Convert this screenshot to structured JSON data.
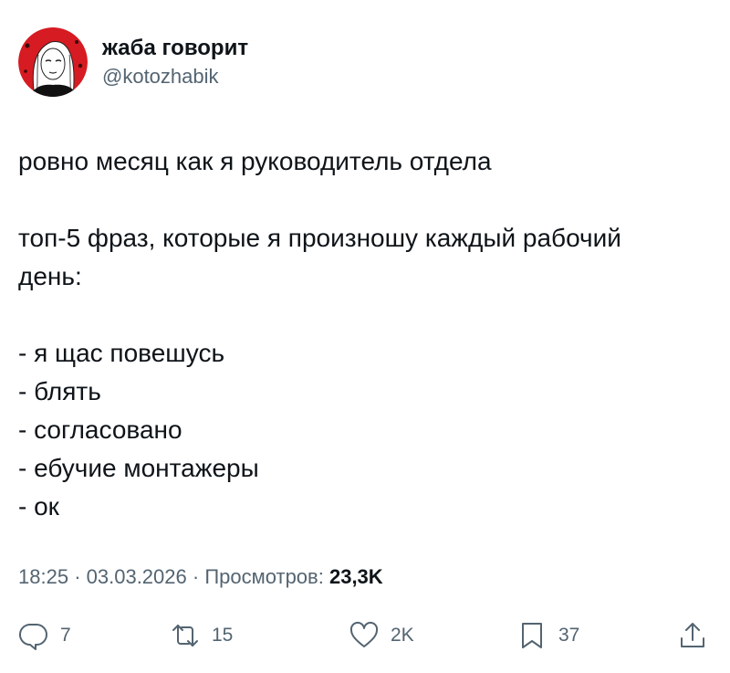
{
  "tweet": {
    "display_name": "жаба говорит",
    "handle": "@kotozhabik",
    "lines": [
      "ровно месяц как я руководитель отдела",
      "",
      "топ-5 фраз, которые я произношу каждый рабочий",
      "день:",
      "",
      "- я щас повешусь",
      "- блять",
      "- согласовано",
      "- ебучие монтажеры",
      "- ок"
    ],
    "meta": {
      "time": "18:25",
      "separator": "·",
      "date": "03.03.2026",
      "views_label": "Просмотров:",
      "views_count": "23,3K"
    },
    "actions": {
      "replies": "7",
      "retweets": "15",
      "likes": "2K",
      "bookmarks": "37"
    }
  },
  "icons": {
    "reply": "reply-icon",
    "retweet": "retweet-icon",
    "like": "heart-icon",
    "bookmark": "bookmark-icon",
    "share": "share-icon"
  },
  "colors": {
    "text": "#0f1419",
    "secondary": "#536471",
    "avatar_red": "#d61b22"
  }
}
